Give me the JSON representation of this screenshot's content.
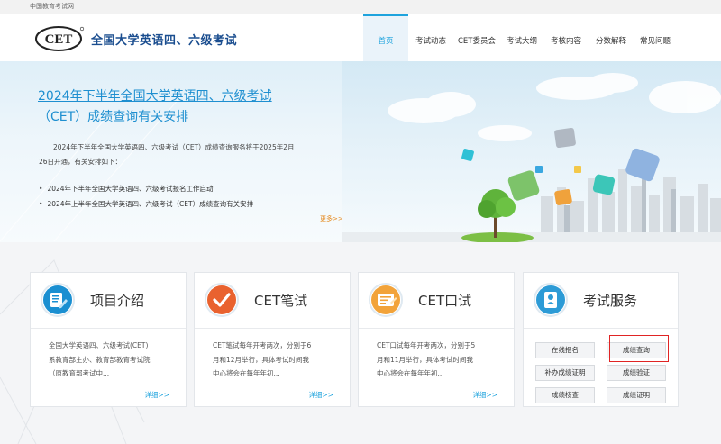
{
  "topbar": {
    "org_link": "中国教育考试网"
  },
  "header": {
    "logo_text": "CET",
    "site_title": "全国大学英语四、六级考试",
    "nav": [
      {
        "label": "首页",
        "active": true
      },
      {
        "label": "考试动态",
        "active": false
      },
      {
        "label": "CET委员会",
        "active": false
      },
      {
        "label": "考试大纲",
        "active": false
      },
      {
        "label": "考核内容",
        "active": false
      },
      {
        "label": "分数解释",
        "active": false
      },
      {
        "label": "常见问题",
        "active": false
      }
    ]
  },
  "banner": {
    "headline_line1": "2024年下半年全国大学英语四、六级考试",
    "headline_line2": "（CET）成绩查询有关安排",
    "intro_line1": "2024年下半年全国大学英语四、六级考试（CET）成绩查询服务将于2025年2月",
    "intro_line2": "26日开通，有关安排如下：",
    "bullets": [
      "2024年下半年全国大学英语四、六级考试报名工作启动",
      "2024年上半年全国大学英语四、六级考试（CET）成绩查询有关安排"
    ],
    "more": "更多>>"
  },
  "cards": {
    "project": {
      "title": "项目介绍",
      "desc_line1": "全国大学英语四、六级考试(CET)",
      "desc_line2": "系教育部主办、教育部教育考试院",
      "desc_line3": "（原教育部考试中...",
      "more": "详细>>",
      "icon": "document-edit-icon"
    },
    "written": {
      "title": "CET笔试",
      "desc_line1": "CET笔试每年开考两次，分别于6",
      "desc_line2": "月和12月举行，具体考试时间我",
      "desc_line3": "中心将会在每年年初...",
      "more": "详细>>",
      "icon": "checkmark-icon"
    },
    "oral": {
      "title": "CET口试",
      "desc_line1": "CET口试每年开考两次，分别于5",
      "desc_line2": "月和11月举行，具体考试时间我",
      "desc_line3": "中心将会在每年年初...",
      "more": "详细>>",
      "icon": "speech-form-icon"
    },
    "service": {
      "title": "考试服务",
      "icon": "id-card-icon",
      "buttons": [
        "在线报名",
        "成绩查询",
        "补办成绩证明",
        "成绩验证",
        "成绩核查",
        "成绩证明"
      ]
    }
  },
  "colors": {
    "accent": "#1ea3dd",
    "headline": "#1e8fd0",
    "nav_title": "#1a4d8f",
    "more_orange": "#e5891c",
    "highlight_red": "#e02424"
  }
}
